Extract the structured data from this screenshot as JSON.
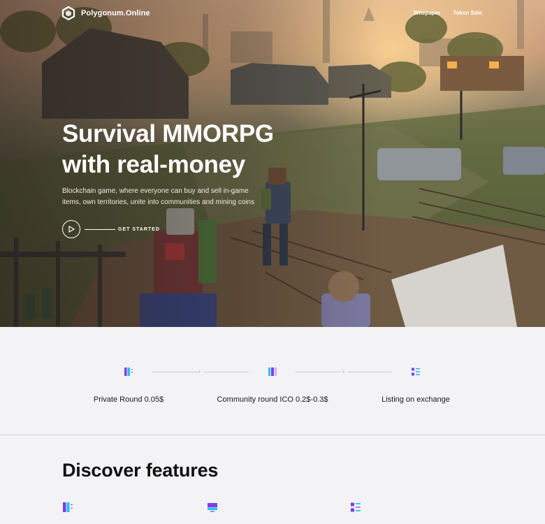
{
  "header": {
    "brand": "Polygonum.Online",
    "logo_icon": "hexagon-logo-icon",
    "nav": [
      {
        "label": "Witepaper"
      },
      {
        "label": "Token Sale"
      }
    ]
  },
  "hero": {
    "title_line1": "Survival MMORPG",
    "title_line2": "with real-money",
    "description": "Blockchain game, where everyone can buy and sell in-game items, own territories, unite into communities and mining coins",
    "cta_label": "GET STARTED",
    "cta_icon": "play-icon"
  },
  "roadmap": {
    "steps": [
      {
        "label": "Private Round 0.05$",
        "icon": "bars-icon"
      },
      {
        "label": "Community round ICO 0.2$-0.3$",
        "icon": "columns-icon"
      },
      {
        "label": "Listing on exchange",
        "icon": "list-icon"
      }
    ],
    "arrow_glyph": "›"
  },
  "features": {
    "title": "Discover features",
    "icons": [
      "bars-icon",
      "window-icon",
      "list-icon"
    ]
  },
  "colors": {
    "accent_purple": "#7a3df0",
    "accent_cyan": "#27c2e8",
    "background": "#f3f3f5",
    "text_dark": "#111111",
    "hero_text": "#ffffff"
  }
}
